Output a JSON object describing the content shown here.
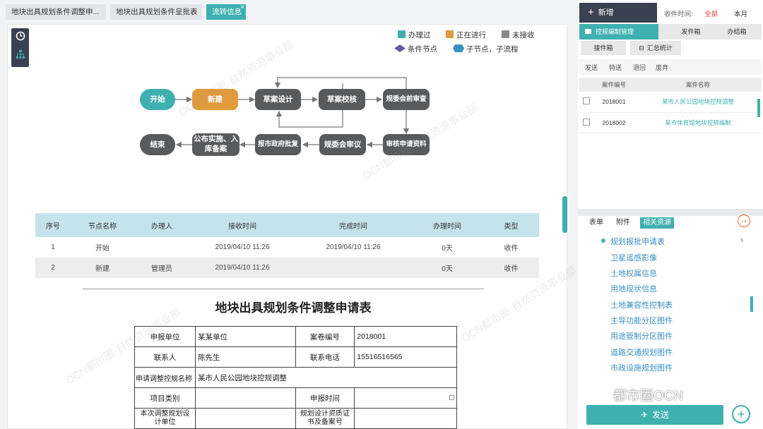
{
  "tabs": [
    {
      "label": "地块出具规划条件调整申..."
    },
    {
      "label": "地块出具规划条件呈批表"
    },
    {
      "label": "流转信息",
      "close": "×"
    }
  ],
  "toolbar": {
    "clock_icon": "clock-icon",
    "tree_icon": "tree-icon"
  },
  "legend": {
    "done": "办理过",
    "doing": "正在进行",
    "pending": "未接收",
    "condition": "条件节点",
    "subnode": "子节点，子流程",
    "colors": {
      "done": "#3fb0b0",
      "doing": "#e19a3c",
      "pending": "#8a8a8a",
      "condition": "#6a5aa6",
      "subnode": "#3a8fc4"
    }
  },
  "flow": {
    "start": "开始",
    "new": "新建",
    "draft_design": "草案设计",
    "draft_review": "草案校核",
    "pre_review": "规委会前审查",
    "check_apply": "审核申请资料",
    "committee_review": "规委会审议",
    "gov_approve": "报市政府批复",
    "publish": "公布实施、入库备案",
    "end": "结束"
  },
  "records": {
    "headers": [
      "序号",
      "节点名称",
      "办理人",
      "接收时间",
      "完成时间",
      "办理时间",
      "类型"
    ],
    "rows": [
      [
        "1",
        "开始",
        "",
        "2019/04/10 11:26",
        "2019/04/10 11:26",
        "0天",
        "收件"
      ],
      [
        "2",
        "新建",
        "管理员",
        "2019/04/10 11:26",
        "",
        "0天",
        "收件"
      ]
    ]
  },
  "document": {
    "title": "地块出具规划条件调整申请表",
    "form": {
      "apply_unit_label": "申报单位",
      "apply_unit": "某某单位",
      "case_no_label": "案卷编号",
      "case_no": "2018001",
      "contact_label": "联系人",
      "contact": "陈先生",
      "phone_label": "联系电话",
      "phone": "15516516565",
      "plan_name_label": "申请调整控规名称",
      "plan_name": "某市人民公园地块控规调整",
      "project_type_label": "项目类别",
      "project_type": "",
      "apply_time_label": "申报时间",
      "apply_time": "",
      "design_unit_label": "本次调整规划设计单位",
      "cert_label": "规划设计资质证书及备案号"
    }
  },
  "watermarks": [
    "OCN都市圈·自然资源事业部",
    "OCN都市圈·自然资源事业部",
    "OCN都市圈·自然资源事业部",
    "OCN都市圈·自然资源事业部"
  ],
  "right": {
    "new_label": "新增",
    "receive_time_label": "收件时间:",
    "filter_all": "全部",
    "filter_month": "本月",
    "folder_label": "控规编制管理",
    "outbox": "发件箱",
    "finished": "办结箱",
    "received": "接件箱",
    "stats": "汇总统计",
    "subtabs": [
      "发送",
      "特送",
      "退回",
      "废弃"
    ],
    "case_headers": [
      "",
      "案件编号",
      "案件名称"
    ],
    "cases": [
      {
        "no": "2018001",
        "name": "某市人民公园地块控规调整"
      },
      {
        "no": "2018002",
        "name": "某市体育馆地块控规编制"
      }
    ],
    "res_tabs": [
      "表单",
      "附件",
      "相关资源"
    ],
    "resources": [
      "规划报批申请表",
      "卫星遥感影像",
      "土地权属信息",
      "用地现状信息",
      "土地兼容性控制表",
      "主导功能分区图件",
      "用途管制分区图件",
      "道路交通规划图件",
      "市政设施规划图件"
    ],
    "send_label": "发送",
    "brand": "都市圈OCN"
  }
}
